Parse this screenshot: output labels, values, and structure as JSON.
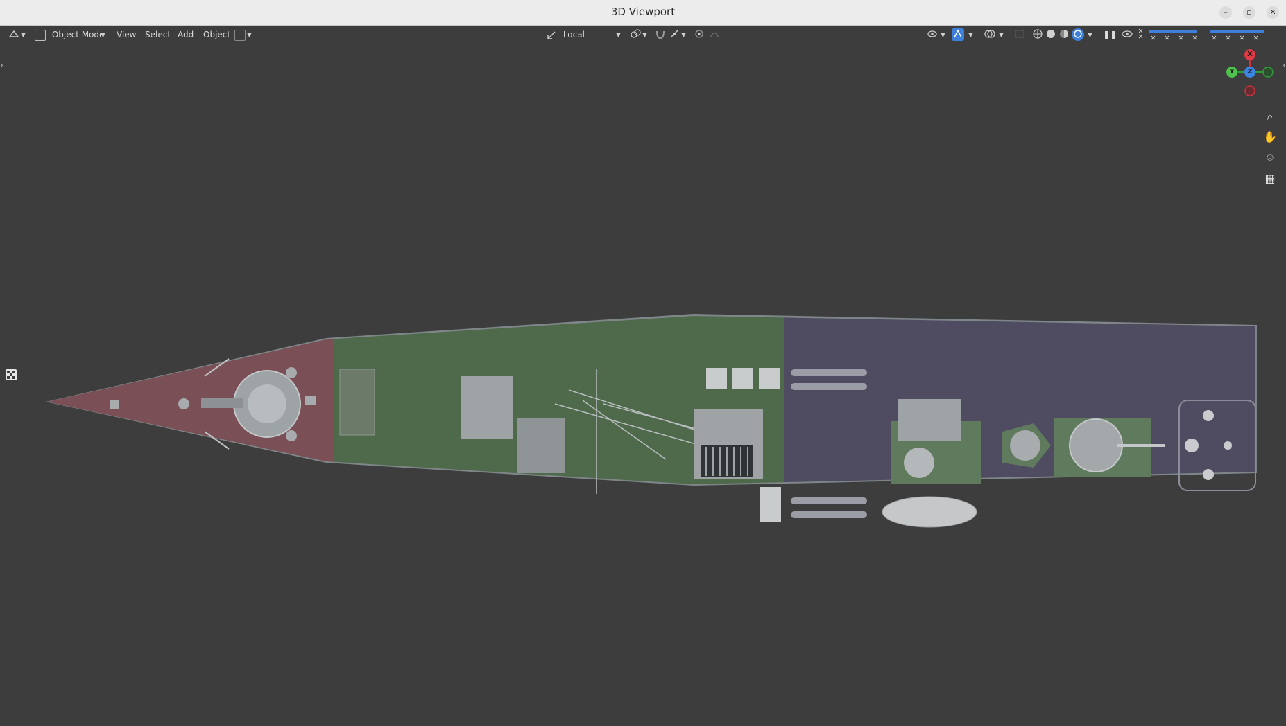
{
  "window": {
    "title": "3D Viewport"
  },
  "header": {
    "mode": "Object Mode",
    "menus": [
      "View",
      "Select",
      "Add",
      "Object"
    ],
    "transform_orientation": "Local"
  },
  "gizmo": {
    "x": "X",
    "y": "Y",
    "z": "Z"
  },
  "colors": {
    "background": "#3d3d3d",
    "bow_paint": "#7a4f56",
    "mid_deck": "#4e6a4b",
    "aft_deck": "#4f4b60",
    "hull_edge": "#8a8f92",
    "accent_blue": "#3d7fd9"
  },
  "icons": {
    "editor_type": "transform-icon",
    "viewport_nav": [
      "zoom-icon",
      "hand-icon",
      "camera-icon",
      "grid-icon"
    ],
    "shading": [
      "wireframe-icon",
      "solid-icon",
      "material-icon",
      "rendered-icon"
    ]
  }
}
